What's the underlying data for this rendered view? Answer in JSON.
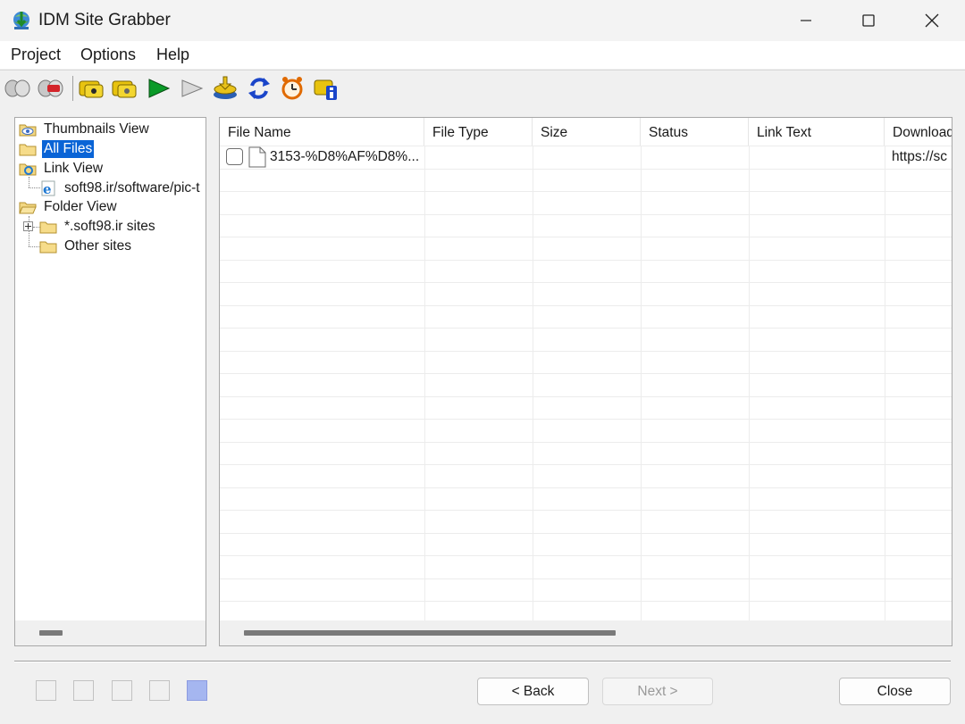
{
  "window": {
    "title": "IDM Site Grabber",
    "controls": {
      "minimize": "minimize-icon",
      "maximize": "maximize-icon",
      "close": "close-icon"
    }
  },
  "menu": [
    "Project",
    "Options",
    "Help"
  ],
  "toolbar": {
    "icons": [
      "connect-icon",
      "disconnect-icon",
      "project-icon",
      "project-settings-icon",
      "start-icon",
      "stop-icon",
      "download-icon",
      "refresh-icon",
      "scheduler-icon",
      "info-icon"
    ]
  },
  "tree": {
    "items": [
      {
        "label": "Thumbnails View",
        "icon": "eye-folder-icon"
      },
      {
        "label": "All Files",
        "icon": "folder-icon",
        "selected": true
      },
      {
        "label": "Link View",
        "icon": "ie-folder-icon"
      },
      {
        "label": "soft98.ir/software/pic-t",
        "icon": "ie-page-icon"
      },
      {
        "label": "Folder View",
        "icon": "open-folder-icon"
      },
      {
        "label": "*.soft98.ir sites",
        "icon": "folder-icon",
        "expandable": true
      },
      {
        "label": "Other sites",
        "icon": "folder-icon"
      }
    ]
  },
  "list": {
    "columns": [
      "File Name",
      "File Type",
      "Size",
      "Status",
      "Link Text",
      "Download"
    ],
    "rows": [
      {
        "checked": false,
        "file_name": "3153-%D8%AF%D8%...",
        "file_type": "",
        "size": "",
        "status": "",
        "link_text": "",
        "download": "https://sc"
      }
    ]
  },
  "wizard": {
    "steps_total": 5,
    "current_step": 5
  },
  "buttons": {
    "back": "< Back",
    "next": "Next >",
    "close": "Close"
  },
  "colors": {
    "selection": "#0a64d6",
    "active_step": "#a5b6f0"
  }
}
